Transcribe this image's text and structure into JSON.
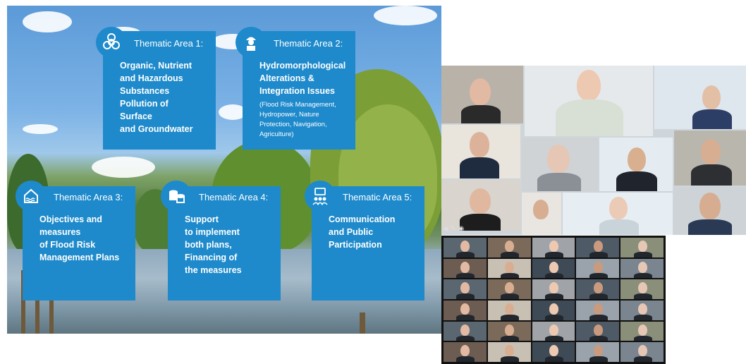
{
  "slide": {
    "areas": [
      {
        "heading": "Thematic Area 1:",
        "lines": [
          "Organic, Nutrient",
          "and Hazardous",
          "Substances",
          "Pollution of",
          "Surface",
          "and Groundwater"
        ],
        "sub": "",
        "icon": "biohazard-icon"
      },
      {
        "heading": "Thematic Area 2:",
        "lines": [
          "Hydromorphological",
          "Alterations &",
          "Integration Issues"
        ],
        "sub": "(Flood Risk Management, Hydropower, Nature Protection, Navigation, Agriculture)",
        "icon": "worker-icon"
      },
      {
        "heading": "Thematic Area 3:",
        "lines": [
          "Objectives and",
          "measures",
          "of Flood Risk",
          "Management Plans"
        ],
        "sub": "",
        "icon": "flood-house-icon"
      },
      {
        "heading": "Thematic Area 4:",
        "lines": [
          "Support",
          "to implement",
          "both plans,",
          "Financing of",
          "the measures"
        ],
        "sub": "",
        "icon": "coins-icon"
      },
      {
        "heading": "Thematic Area 5:",
        "lines": [
          "Communication",
          "and Public",
          "Participation"
        ],
        "sub": "",
        "icon": "chat-people-icon"
      }
    ],
    "colors": {
      "card": "#1e8acb",
      "text": "#ffffff"
    }
  },
  "gallery_small": {
    "tile_labels": [
      "",
      "",
      "",
      "",
      "",
      "",
      "",
      "",
      "",
      "",
      "",
      ""
    ]
  },
  "gallery_large": {
    "rows": 6,
    "cols": 5
  }
}
